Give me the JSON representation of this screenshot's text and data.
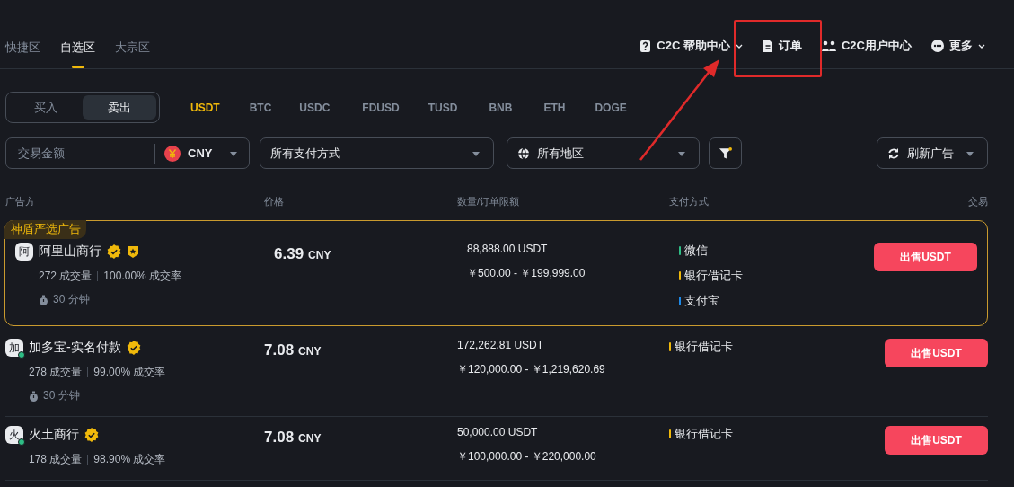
{
  "top_nav": {
    "tabs": [
      {
        "label": "快捷区",
        "selected": false
      },
      {
        "label": "自选区",
        "selected": true
      },
      {
        "label": "大宗区",
        "selected": false
      }
    ],
    "links": [
      {
        "kind": "help",
        "label": "C2C 帮助中心",
        "dropdown": true,
        "highlighted": false
      },
      {
        "kind": "orders",
        "label": "订单",
        "dropdown": false,
        "highlighted": true
      },
      {
        "kind": "users",
        "label": "C2C用户中心",
        "dropdown": false,
        "highlighted": false
      },
      {
        "kind": "more",
        "label": "更多",
        "dropdown": true,
        "highlighted": false
      }
    ]
  },
  "trade_side": [
    {
      "label": "买入",
      "selected": false
    },
    {
      "label": "卖出",
      "selected": true
    }
  ],
  "assets": [
    {
      "label": "USDT",
      "selected": true
    },
    {
      "label": "BTC",
      "selected": false
    },
    {
      "label": "USDC",
      "selected": false
    },
    {
      "label": "FDUSD",
      "selected": false
    },
    {
      "label": "TUSD",
      "selected": false
    },
    {
      "label": "BNB",
      "selected": false
    },
    {
      "label": "ETH",
      "selected": false
    },
    {
      "label": "DOGE",
      "selected": false
    }
  ],
  "filters": {
    "amount": {
      "placeholder": "交易金额"
    },
    "currency": "CNY",
    "payment": "所有支付方式",
    "region": "所有地区",
    "refresh": "刷新广告"
  },
  "table": {
    "columns": [
      "广告方",
      "价格",
      "数量/订单限额",
      "支付方式",
      "交易"
    ],
    "rows": [
      {
        "featured": true,
        "featured_label": "神盾严选广告",
        "avatar": "阿",
        "online": false,
        "name": "阿里山商行",
        "verified": true,
        "shield": true,
        "orders": "272 成交量",
        "completion": "100.00% 成交率",
        "time": "30 分钟",
        "price": "6.39",
        "currency": "CNY",
        "quantity": "88,888.00 USDT",
        "limits": "￥500.00 - ￥199,999.00",
        "payments": [
          {
            "label": "微信",
            "color": "#2ebd85"
          },
          {
            "label": "银行借记卡",
            "color": "#f0b90b"
          },
          {
            "label": "支付宝",
            "color": "#1e88e5"
          }
        ],
        "action": "出售USDT"
      },
      {
        "featured": false,
        "avatar": "加",
        "online": true,
        "name": "加多宝-实名付款",
        "verified": true,
        "shield": false,
        "orders": "278 成交量",
        "completion": "99.00% 成交率",
        "time": "30 分钟",
        "price": "7.08",
        "currency": "CNY",
        "quantity": "172,262.81 USDT",
        "limits": "￥120,000.00 - ￥1,219,620.69",
        "payments": [
          {
            "label": "银行借记卡",
            "color": "#f0b90b"
          }
        ],
        "action": "出售USDT"
      },
      {
        "featured": false,
        "avatar": "火",
        "online": true,
        "name": "火土商行",
        "verified": true,
        "shield": false,
        "orders": "178 成交量",
        "completion": "98.90% 成交率",
        "price": "7.08",
        "currency": "CNY",
        "quantity": "50,000.00 USDT",
        "limits": "￥100,000.00 - ￥220,000.00",
        "payments": [
          {
            "label": "银行借记卡",
            "color": "#f0b90b"
          }
        ],
        "action": "出售USDT"
      }
    ]
  }
}
